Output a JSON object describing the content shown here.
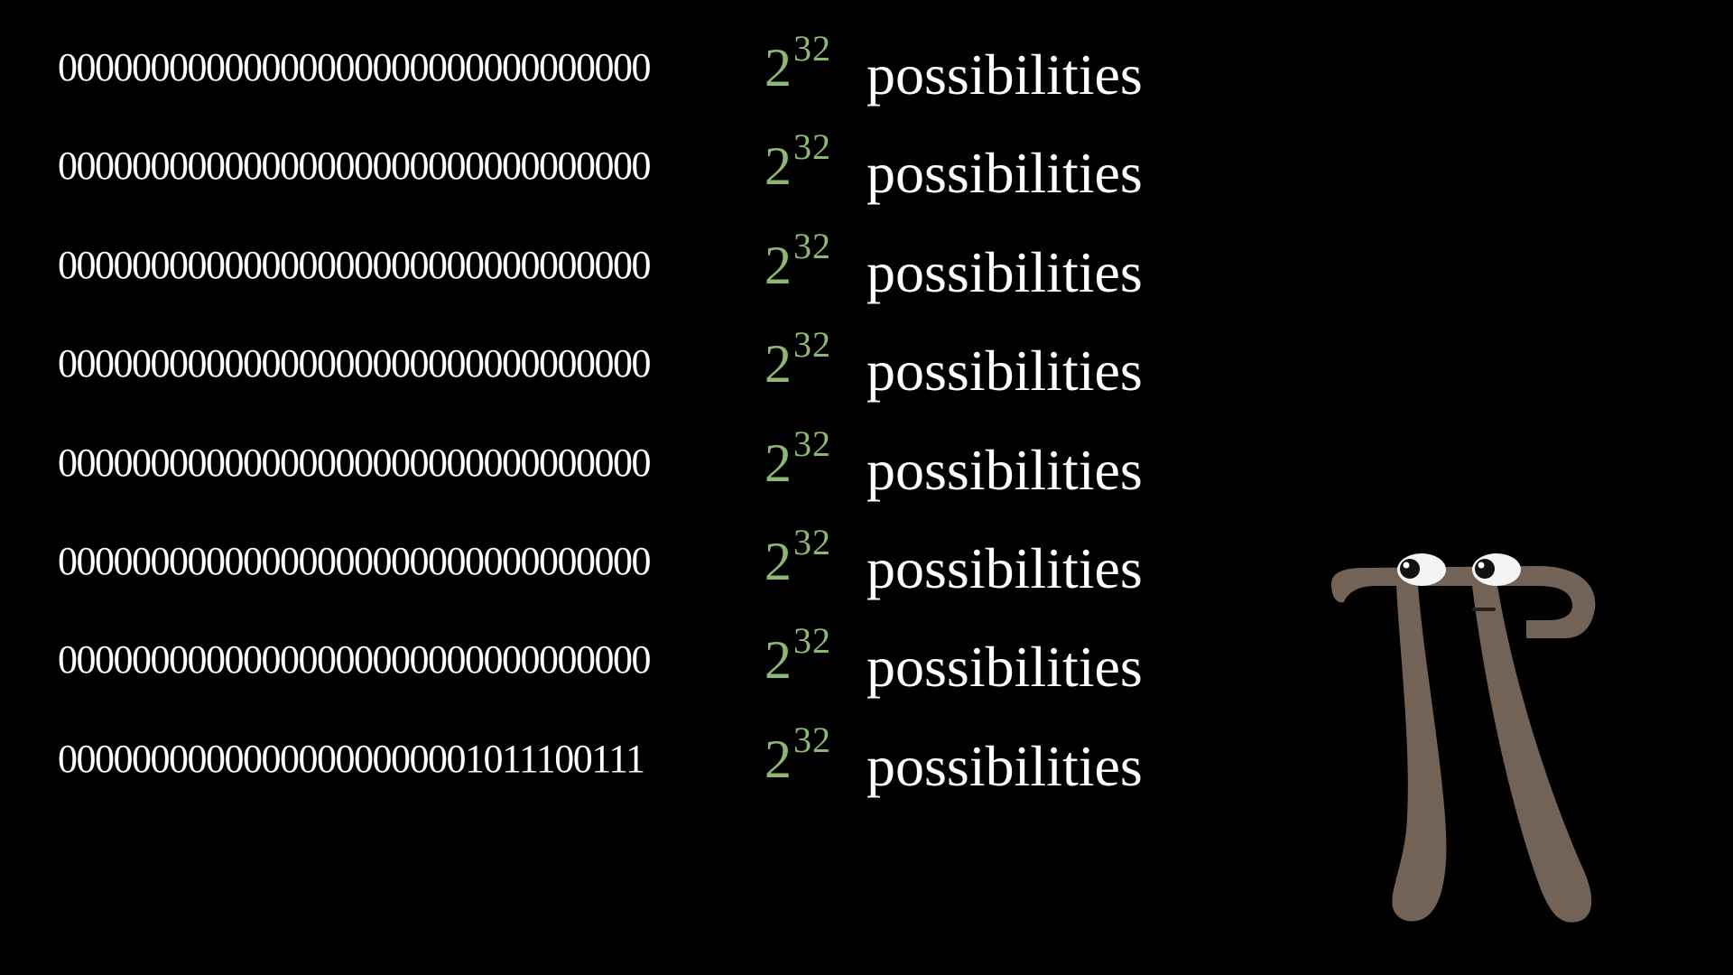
{
  "rows": [
    {
      "bits": "00000000000000000000000000000000",
      "base": "2",
      "exponent": "32",
      "word": "possibilities"
    },
    {
      "bits": "00000000000000000000000000000000",
      "base": "2",
      "exponent": "32",
      "word": "possibilities"
    },
    {
      "bits": "00000000000000000000000000000000",
      "base": "2",
      "exponent": "32",
      "word": "possibilities"
    },
    {
      "bits": "00000000000000000000000000000000",
      "base": "2",
      "exponent": "32",
      "word": "possibilities"
    },
    {
      "bits": "00000000000000000000000000000000",
      "base": "2",
      "exponent": "32",
      "word": "possibilities"
    },
    {
      "bits": "00000000000000000000000000000000",
      "base": "2",
      "exponent": "32",
      "word": "possibilities"
    },
    {
      "bits": "00000000000000000000000000000000",
      "base": "2",
      "exponent": "32",
      "word": "possibilities"
    },
    {
      "bits": "00000000000000000000001011100111",
      "base": "2",
      "exponent": "32",
      "word": "possibilities"
    }
  ],
  "colors": {
    "background": "#000000",
    "text": "#ffffff",
    "power": "#8cb872",
    "pi_body": "#736357"
  },
  "icons": {
    "character": "pi-creature-icon"
  }
}
